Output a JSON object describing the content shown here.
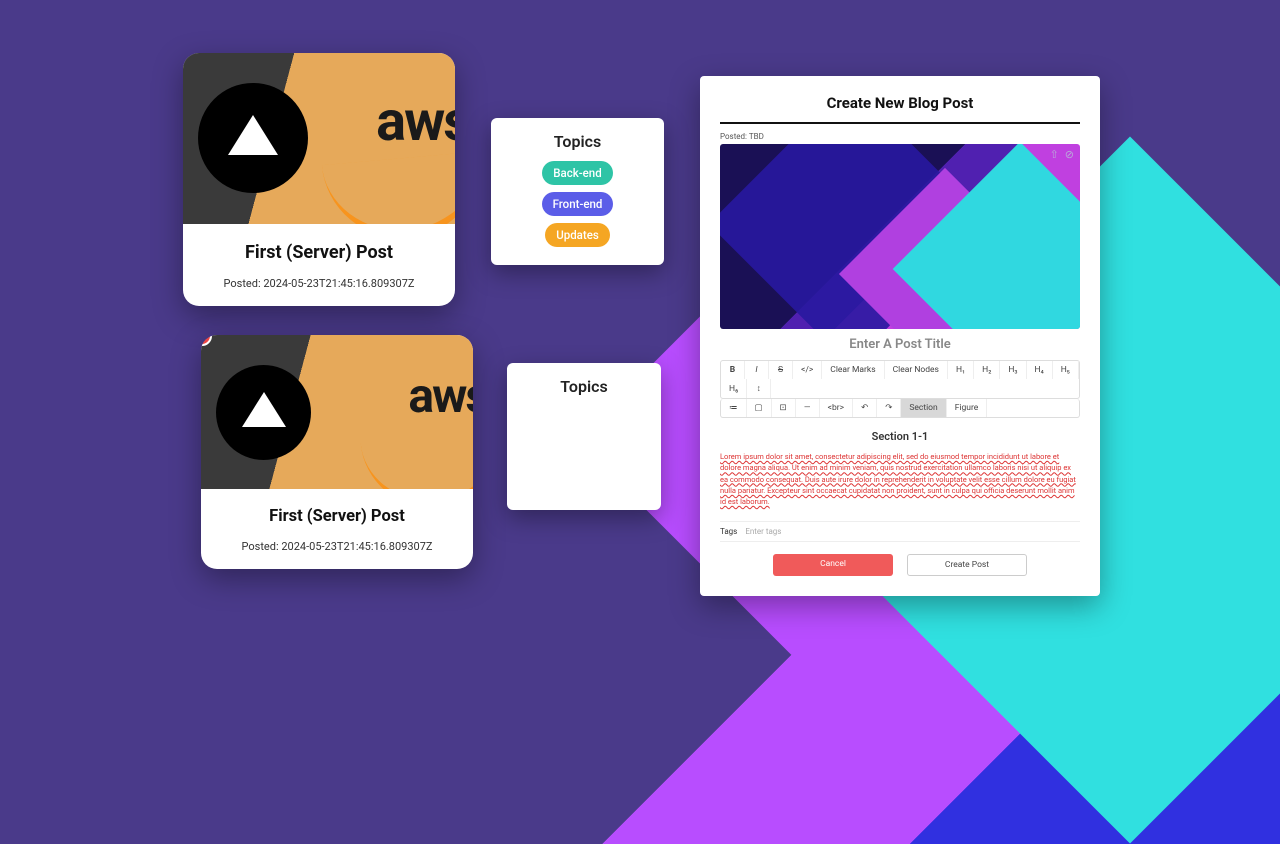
{
  "post_card": {
    "title": "First (Server) Post",
    "posted_label": "Posted: 2024-05-23T21:45:16.809307Z",
    "aws_text": "aws"
  },
  "topics": {
    "heading": "Topics",
    "items": [
      {
        "label": "Back-end",
        "cls": "be"
      },
      {
        "label": "Front-end",
        "cls": "fe"
      },
      {
        "label": "Updates",
        "cls": "up"
      }
    ]
  },
  "editor": {
    "heading": "Create New Blog Post",
    "posted": "Posted: TBD",
    "title_placeholder": "Enter A Post Title",
    "toolbar_row1": [
      "B",
      "I",
      "S",
      "</>",
      "Clear Marks",
      "Clear Nodes",
      "H₁",
      "H₂",
      "H₃",
      "H₄",
      "H₅",
      "H₆",
      "↕"
    ],
    "toolbar_row2": [
      "≔",
      "▢",
      "⊡",
      "—",
      "<br>",
      "↶",
      "↷",
      "Section",
      "Figure"
    ],
    "section_label": "Section 1-1",
    "body": "Lorem ipsum dolor sit amet, consectetur adipiscing elit, sed do eiusmod tempor incididunt ut labore et dolore magna aliqua. Ut enim ad minim veniam, quis nostrud exercitation ullamco laboris nisi ut aliquip ex ea commodo consequat. Duis aute irure dolor in reprehenderit in voluptate velit esse cillum dolore eu fugiat nulla pariatur. Excepteur sint occaecat cupidatat non proident, sunt in culpa qui officia deserunt mollit anim id est laborum.",
    "tags_label": "Tags",
    "tags_placeholder": "Enter tags",
    "cancel": "Cancel",
    "create": "Create Post"
  }
}
